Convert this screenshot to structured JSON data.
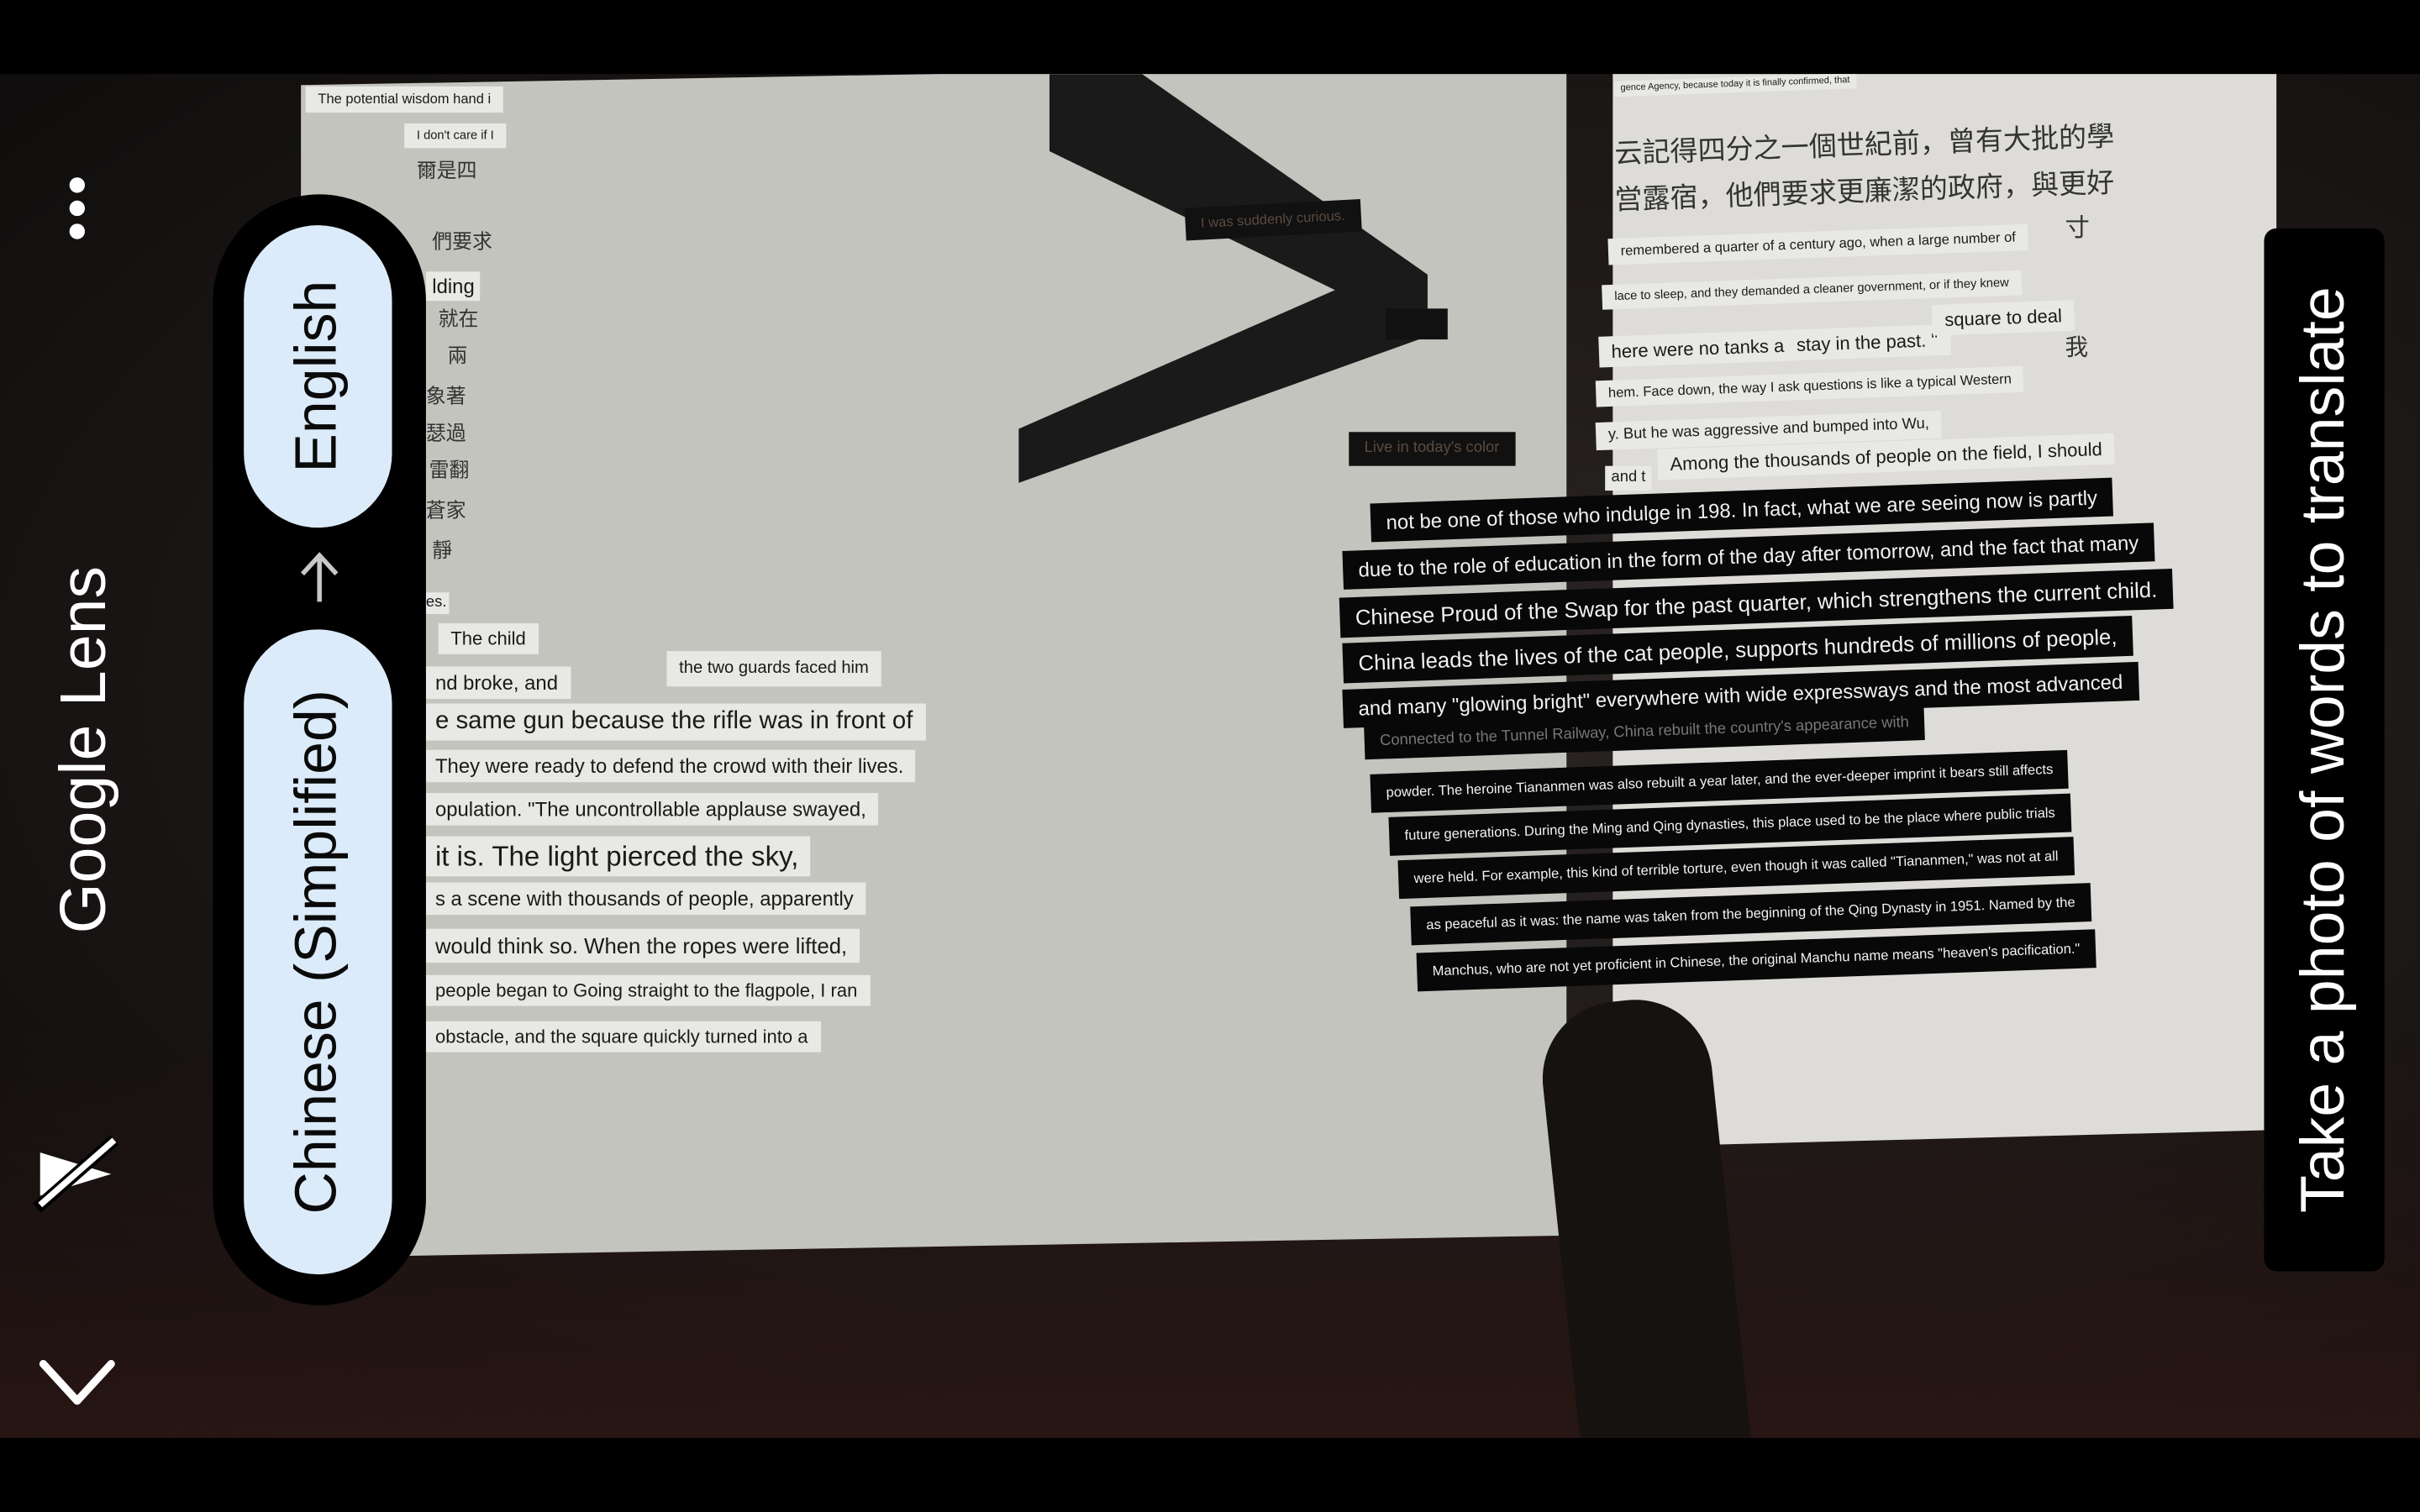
{
  "app": {
    "title": "Google Lens",
    "menu_icon": "more-vert-icon",
    "flash_icon": "flash-off-icon",
    "collapse_icon": "chevron-down-icon"
  },
  "languages": {
    "source": "Chinese (Simplified)",
    "target": "English",
    "swap_icon": "arrow-right-icon"
  },
  "hint": "Take a photo of words to translate",
  "colors": {
    "pill_bg": "#dcebfa",
    "panel_bg": "#000000",
    "text_on_dark": "#ffffff"
  },
  "scene": {
    "left_overlays": [
      "The potential wisdom hand i",
      "I don't care if I",
      "lding",
      "The child",
      "nd broke, and",
      "the two guards faced him",
      "e same gun because the rifle was in front of",
      "They were ready to defend the crowd with their lives.",
      "opulation. \"The uncontrollable applause swayed,",
      "it is. The light pierced the sky,",
      "s a scene with thousands of people, apparently",
      "would think so. When the ropes were lifted,",
      "people began to Going straight to the flagpole, I ran",
      "obstacle, and the square quickly turned into a",
      "es."
    ],
    "left_chinese": [
      "爾是四",
      "們要求",
      "就在",
      "兩",
      "象著",
      "瑟過",
      "雷翻",
      "蒼家",
      "靜"
    ],
    "center_overlays": [
      "I was suddenly curious.",
      "Live in today's color"
    ],
    "right_top_overlays": [
      "gence Agency, because today it is finally confirmed, that",
      "remembered a quarter of a century ago, when a large number of",
      "lace to sleep, and they demanded a cleaner government, or if they knew",
      "here were no tanks a",
      "stay in the past. \"",
      "square to deal",
      "hem. Face down, the way I ask questions is like a typical Western",
      "y. But he was aggressive and bumped into Wu,",
      "and t",
      "Among the thousands of people on the field, I should"
    ],
    "right_chinese": [
      "云記得四分之一個世紀前，曾有大批的學",
      "営露宿，他們要求更廉潔的政府，與更好",
      "寸",
      "我"
    ],
    "right_dark_overlays": [
      "not be one of those who indulge in 198. In fact, what we are seeing now is partly",
      "due to the role of education in the form of the day after tomorrow, and the fact that many",
      "Chinese Proud of the Swap for the past quarter, which strengthens the current child.",
      "China leads the lives of the cat people, supports hundreds of millions of people,",
      "and many \"glowing bright\" everywhere with wide expressways and the most advanced",
      "Connected to the Tunnel Railway, China rebuilt the country's appearance with",
      "powder. The heroine Tiananmen was also rebuilt a year later, and the ever-deeper imprint it bears still affects",
      "future generations. During the Ming and Qing dynasties, this place used to be the place where public trials",
      "were held. For example, this kind of terrible torture, even though it was called \"Tiananmen,\" was not at all",
      "as peaceful as it was: the name was taken from the beginning of the Qing Dynasty in 1951. Named by the",
      "Manchus, who are not yet proficient in Chinese, the original Manchu name means \"heaven's pacification.\""
    ]
  }
}
